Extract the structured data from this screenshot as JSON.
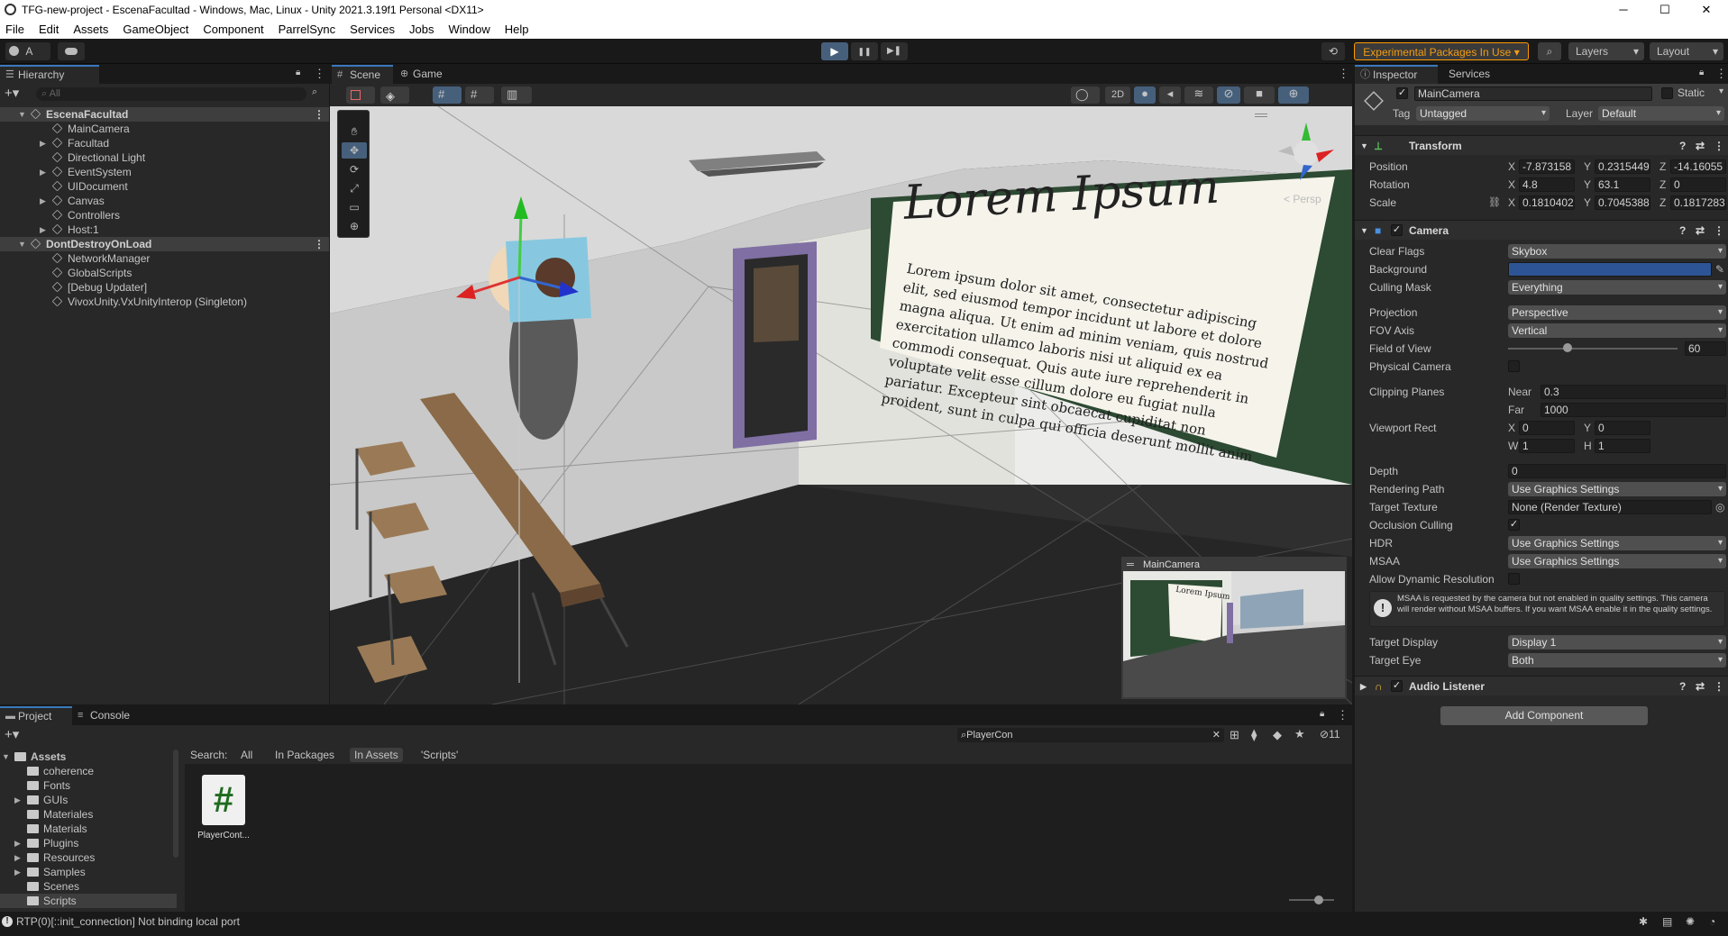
{
  "window": {
    "title": "TFG-new-project - EscenaFacultad - Windows, Mac, Linux - Unity 2021.3.19f1 Personal <DX11>",
    "controls": {
      "minimize": "─",
      "maximize": "☐",
      "close": "✕"
    }
  },
  "menu": [
    "File",
    "Edit",
    "Assets",
    "GameObject",
    "Component",
    "ParrelSync",
    "Services",
    "Jobs",
    "Window",
    "Help"
  ],
  "toolbar": {
    "account_label": "A",
    "play": "▶",
    "pause": "❚❚",
    "step": "▶❚",
    "experimental": "Experimental Packages In Use",
    "layers": "Layers",
    "layout": "Layout"
  },
  "hierarchy": {
    "tab": "Hierarchy",
    "search_placeholder": "All",
    "rows": [
      {
        "label": "EscenaFacultad",
        "scene": true,
        "indent": 0,
        "arrow": "▼"
      },
      {
        "label": "MainCamera",
        "indent": 1,
        "arrow": ""
      },
      {
        "label": "Facultad",
        "indent": 1,
        "arrow": "▶"
      },
      {
        "label": "Directional Light",
        "indent": 1,
        "arrow": ""
      },
      {
        "label": "EventSystem",
        "indent": 1,
        "arrow": "▶"
      },
      {
        "label": "UIDocument",
        "indent": 1,
        "arrow": ""
      },
      {
        "label": "Canvas",
        "indent": 1,
        "arrow": "▶"
      },
      {
        "label": "Controllers",
        "indent": 1,
        "arrow": ""
      },
      {
        "label": "Host:1",
        "indent": 1,
        "arrow": "▶"
      },
      {
        "label": "DontDestroyOnLoad",
        "scene": true,
        "indent": 0,
        "arrow": "▼"
      },
      {
        "label": "NetworkManager",
        "indent": 1,
        "arrow": ""
      },
      {
        "label": "GlobalScripts",
        "indent": 1,
        "arrow": ""
      },
      {
        "label": "[Debug Updater]",
        "indent": 1,
        "arrow": ""
      },
      {
        "label": "VivoxUnity.VxUnityInterop (Singleton)",
        "indent": 1,
        "arrow": ""
      }
    ]
  },
  "scene": {
    "tabs": [
      "Scene",
      "Game"
    ],
    "mode_2d": "2D",
    "persp": "< Persp",
    "board_title": "Lorem Ipsum",
    "board_text": "Lorem ipsum dolor sit amet, consectetur adipiscing elit, sed eiusmod tempor incidunt ut labore et dolore magna aliqua. Ut enim ad minim veniam, quis nostrud exercitation ullamco laboris nisi ut aliquid ex ea commodi consequat. Quis aute iure reprehenderit in voluptate velit esse cillum dolore eu fugiat nulla pariatur. Excepteur sint obcaecat cupiditat non proident, sunt in culpa qui officia deserunt mollit anim id est laborum.",
    "preview_title": "MainCamera",
    "preview_board": "Lorem Ipsum"
  },
  "inspector": {
    "tabs": [
      "Inspector",
      "Services"
    ],
    "object_name": "MainCamera",
    "static_label": "Static",
    "tag_label": "Tag",
    "tag_value": "Untagged",
    "layer_label": "Layer",
    "layer_value": "Default",
    "transform": {
      "title": "Transform",
      "position": {
        "label": "Position",
        "x": "-7.873158",
        "y": "0.2315449",
        "z": "-14.16055"
      },
      "rotation": {
        "label": "Rotation",
        "x": "4.8",
        "y": "63.1",
        "z": "0"
      },
      "scale": {
        "label": "Scale",
        "x": "0.1810402",
        "y": "0.7045388",
        "z": "0.1817283"
      }
    },
    "camera": {
      "title": "Camera",
      "clear_flags": {
        "label": "Clear Flags",
        "value": "Skybox"
      },
      "background": {
        "label": "Background",
        "color": "#2d5595"
      },
      "culling_mask": {
        "label": "Culling Mask",
        "value": "Everything"
      },
      "projection": {
        "label": "Projection",
        "value": "Perspective"
      },
      "fov_axis": {
        "label": "FOV Axis",
        "value": "Vertical"
      },
      "fov": {
        "label": "Field of View",
        "value": "60",
        "slider_fraction": 0.35
      },
      "physical": {
        "label": "Physical Camera"
      },
      "clipping": {
        "label": "Clipping Planes",
        "near_label": "Near",
        "near": "0.3",
        "far_label": "Far",
        "far": "1000"
      },
      "viewport": {
        "label": "Viewport Rect",
        "x": "0",
        "y": "0",
        "w": "1",
        "h": "1"
      },
      "depth": {
        "label": "Depth",
        "value": "0"
      },
      "rendering_path": {
        "label": "Rendering Path",
        "value": "Use Graphics Settings"
      },
      "target_texture": {
        "label": "Target Texture",
        "value": "None (Render Texture)"
      },
      "occlusion": {
        "label": "Occlusion Culling"
      },
      "hdr": {
        "label": "HDR",
        "value": "Use Graphics Settings"
      },
      "msaa": {
        "label": "MSAA",
        "value": "Use Graphics Settings"
      },
      "dynres": {
        "label": "Allow Dynamic Resolution"
      },
      "warning": "MSAA is requested by the camera but not enabled in quality settings. This camera will render without MSAA buffers. If you want MSAA enable it in the quality settings.",
      "target_display": {
        "label": "Target Display",
        "value": "Display 1"
      },
      "target_eye": {
        "label": "Target Eye",
        "value": "Both"
      }
    },
    "audio_listener": "Audio Listener",
    "add_component": "Add Component"
  },
  "project": {
    "tabs": [
      "Project",
      "Console"
    ],
    "search_value": "PlayerCon",
    "hidden_count": "11",
    "search_label": "Search:",
    "filters": [
      "All",
      "In Packages",
      "In Assets",
      "'Scripts'"
    ],
    "tree": [
      {
        "label": "Assets",
        "root": true
      },
      {
        "label": "coherence"
      },
      {
        "label": "Fonts"
      },
      {
        "label": "GUIs",
        "arrow": true
      },
      {
        "label": "Materiales"
      },
      {
        "label": "Materials"
      },
      {
        "label": "Plugins",
        "arrow": true
      },
      {
        "label": "Resources",
        "arrow": true
      },
      {
        "label": "Samples",
        "arrow": true
      },
      {
        "label": "Scenes"
      },
      {
        "label": "Scripts",
        "selected": true
      }
    ],
    "asset": {
      "label": "PlayerCont...",
      "glyph": "#"
    }
  },
  "status": {
    "message": "RTP(0)[::init_connection] Not binding local port"
  }
}
